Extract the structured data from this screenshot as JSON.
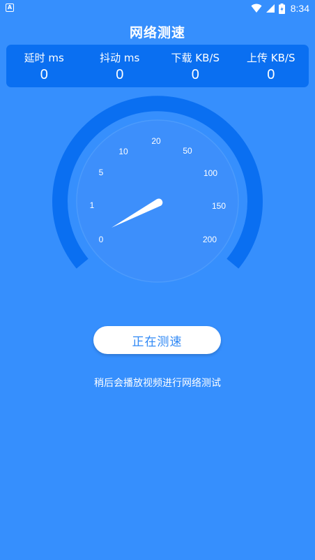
{
  "status_bar": {
    "time": "8:34",
    "app_icon_letter": "A"
  },
  "title": "网络测速",
  "stats": [
    {
      "label": "延时 ms",
      "value": "0"
    },
    {
      "label": "抖动 ms",
      "value": "0"
    },
    {
      "label": "下载 KB/S",
      "value": "0"
    },
    {
      "label": "上传 KB/S",
      "value": "0"
    }
  ],
  "gauge": {
    "tick_labels": [
      "0",
      "1",
      "5",
      "10",
      "20",
      "50",
      "100",
      "150",
      "200"
    ],
    "colors": {
      "outer_ring": "#0a6ff1",
      "inner_dial": "#3d8ffb",
      "needle": "#ffffff"
    }
  },
  "button": {
    "label": "正在测速"
  },
  "notice": "稍后会播放视频进行网络测试",
  "colors": {
    "background": "#368ffd",
    "panel": "#0a6ff1",
    "button_text": "#2f88f5"
  }
}
